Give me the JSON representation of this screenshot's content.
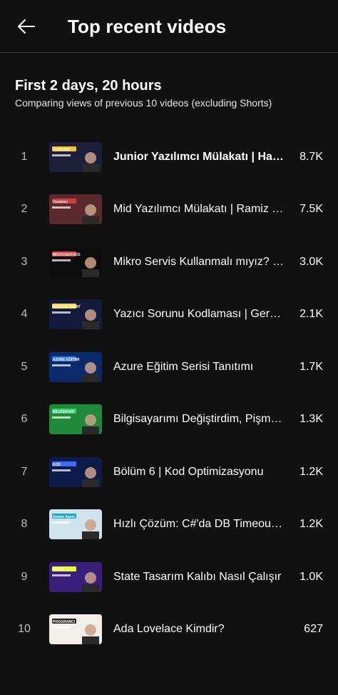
{
  "header": {
    "title": "Top recent videos"
  },
  "section": {
    "title": "First 2 days, 20 hours",
    "subtitle": "Comparing views of previous 10 videos (excluding Shorts)"
  },
  "videos": [
    {
      "rank": "1",
      "title": "Junior Yazılımcı Mülakatı | Hacker Rank",
      "views": "8.7K",
      "thumb_bg": "#1d1f3a",
      "thumb_accent": "#f4c430",
      "thumb_text": "YAZILIMCI"
    },
    {
      "rank": "2",
      "title": "Mid Yazılımcı Mülakatı | Ramiz Rahimov",
      "views": "7.5K",
      "thumb_bg": "#5a2a2e",
      "thumb_accent": "#d23c3c",
      "thumb_text": "Yazılımcı"
    },
    {
      "rank": "3",
      "title": "Mikro Servis Kullanmalı mıyız? Backend",
      "views": "3.0K",
      "thumb_bg": "#0d0d0d",
      "thumb_accent": "#e63b3b",
      "thumb_text": "MICROSERVICE"
    },
    {
      "rank": "4",
      "title": "Yazıcı Sorunu Kodlaması | Gerçek Hayat",
      "views": "2.1K",
      "thumb_bg": "#141a3c",
      "thumb_accent": "#ffd54a",
      "thumb_text": "GERÇEK HAYAT"
    },
    {
      "rank": "5",
      "title": "Azure Eğitim Serisi Tanıtımı",
      "views": "1.7K",
      "thumb_bg": "#0a2a6b",
      "thumb_accent": "#2e7bff",
      "thumb_text": "AZURE EĞİTİMİ"
    },
    {
      "rank": "6",
      "title": "Bilgisayarımı Değiştirdim, Pişman Oldum",
      "views": "1.3K",
      "thumb_bg": "#1f8a3a",
      "thumb_accent": "#35d06b",
      "thumb_text": "BİLGİSAYAR"
    },
    {
      "rank": "7",
      "title": "Bölüm 6 | Kod Optimizasyonu",
      "views": "1.2K",
      "thumb_bg": "#0e1a4a",
      "thumb_accent": "#3b6cff",
      "thumb_text": "KOD"
    },
    {
      "rank": "8",
      "title": "Hızlı Çözüm: C#'da DB Timeout Hatası",
      "views": "1.2K",
      "thumb_bg": "#cfe3ec",
      "thumb_accent": "#1aa6c8",
      "thumb_text": "Zaman Aşımı"
    },
    {
      "rank": "9",
      "title": "State Tasarım Kalıbı Nasıl Çalışır",
      "views": "1.0K",
      "thumb_bg": "#3a1f7a",
      "thumb_accent": "#e6ff3b",
      "thumb_text": "STATE"
    },
    {
      "rank": "10",
      "title": "Ada Lovelace Kimdir?",
      "views": "627",
      "thumb_bg": "#f2efe9",
      "thumb_accent": "#222222",
      "thumb_text": "PROGRAMCI"
    }
  ]
}
